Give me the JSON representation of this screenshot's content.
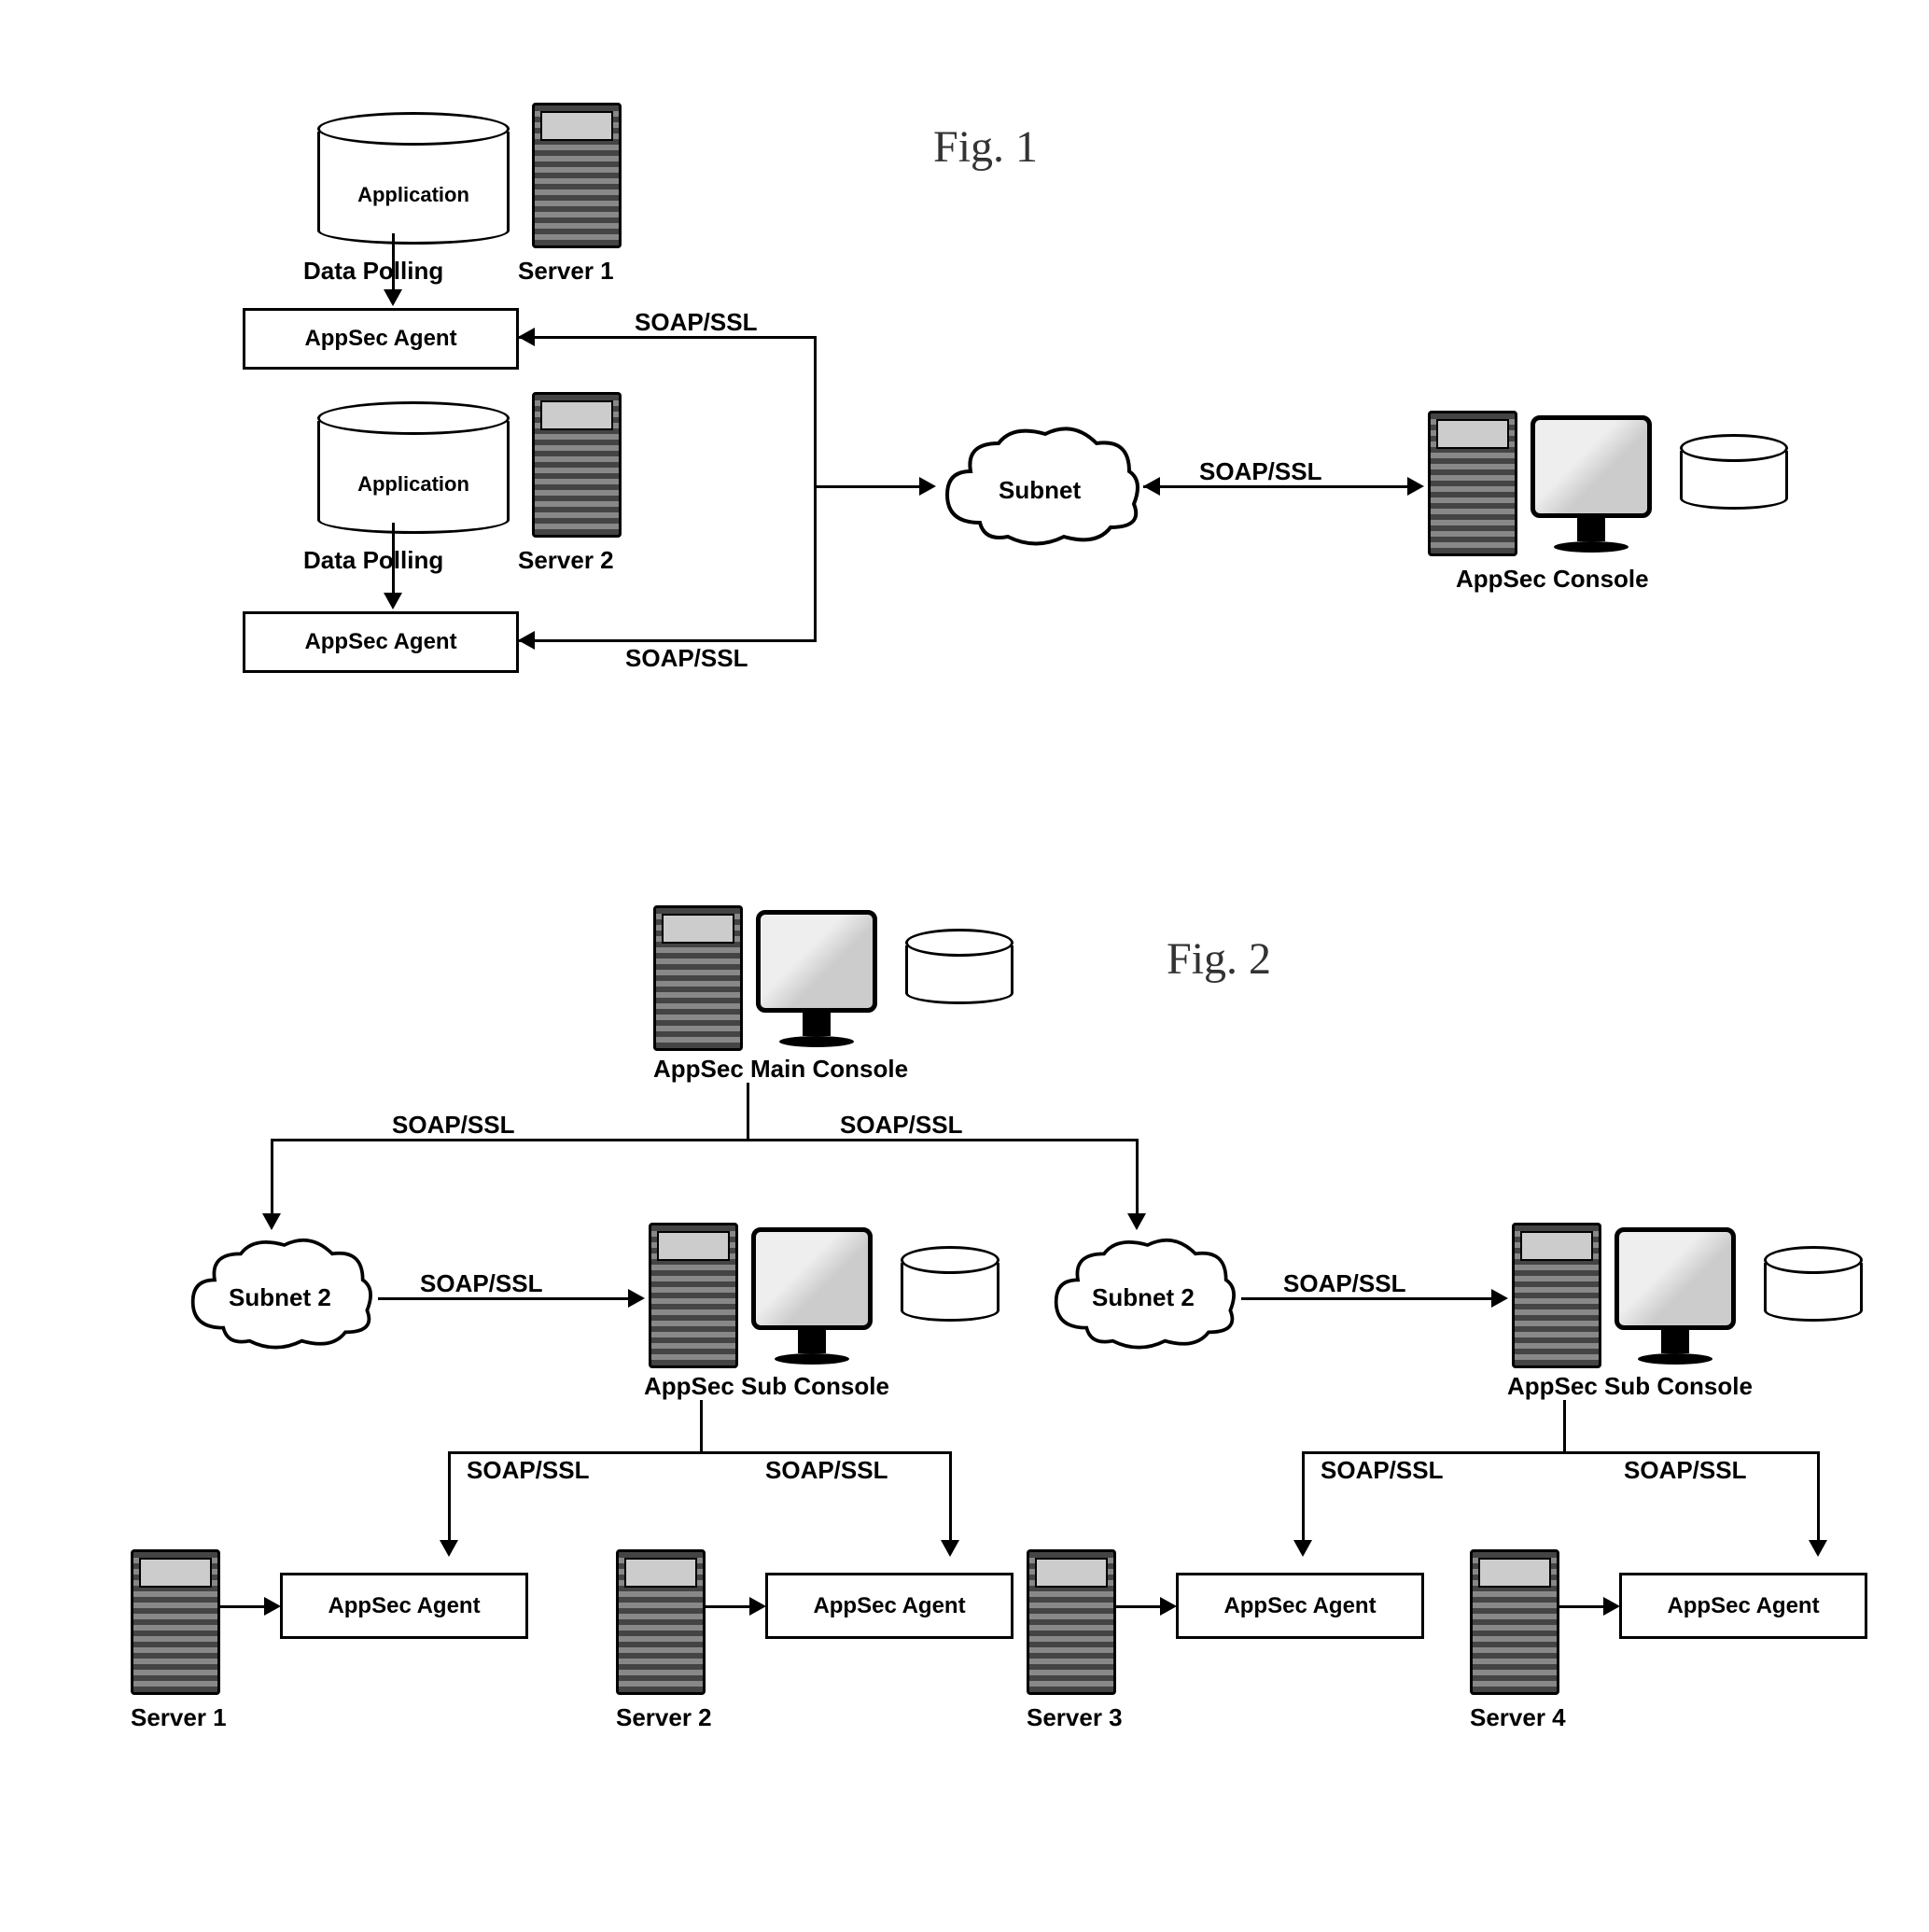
{
  "fig1": {
    "title": "Fig. 1",
    "nodes": {
      "app1": "Application",
      "data_polling1": "Data Polling",
      "server1": "Server 1",
      "agent1": "AppSec Agent",
      "app2": "Application",
      "data_polling2": "Data Polling",
      "server2": "Server 2",
      "agent2": "AppSec Agent",
      "protocol1": "SOAP/SSL",
      "protocol2": "SOAP/SSL",
      "subnet": "Subnet",
      "protocol3": "SOAP/SSL",
      "console": "AppSec Console"
    }
  },
  "fig2": {
    "title": "Fig. 2",
    "nodes": {
      "main_console": "AppSec Main Console",
      "protocol_top_l": "SOAP/SSL",
      "protocol_top_r": "SOAP/SSL",
      "subnet_l": "Subnet 2",
      "subnet_r": "Subnet 2",
      "protocol_sub_l": "SOAP/SSL",
      "protocol_sub_r": "SOAP/SSL",
      "sub_console_l": "AppSec Sub Console",
      "sub_console_r": "AppSec Sub Console",
      "protocol_bl1": "SOAP/SSL",
      "protocol_bl2": "SOAP/SSL",
      "protocol_br1": "SOAP/SSL",
      "protocol_br2": "SOAP/SSL",
      "server1": "Server 1",
      "server2": "Server 2",
      "server3": "Server 3",
      "server4": "Server 4",
      "agent1": "AppSec Agent",
      "agent2": "AppSec Agent",
      "agent3": "AppSec Agent",
      "agent4": "AppSec Agent"
    }
  }
}
